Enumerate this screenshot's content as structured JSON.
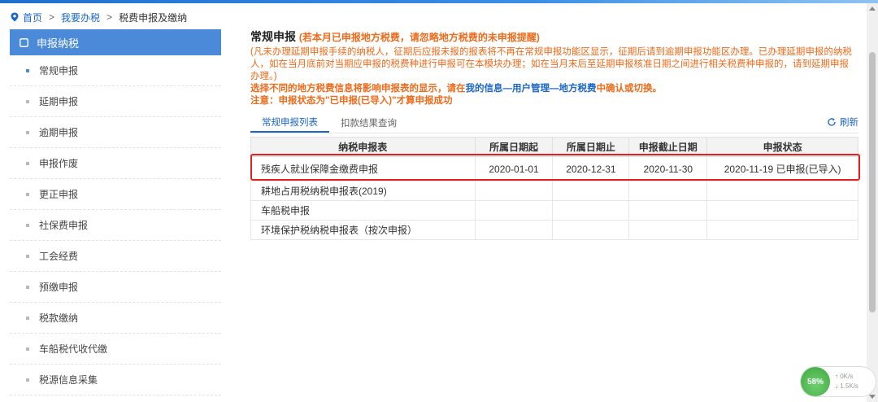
{
  "breadcrumb": {
    "home": "首页",
    "sep": ">",
    "level2": "我要办税",
    "current": "税费申报及缴纳"
  },
  "sidebar": {
    "header": "申报纳税",
    "items": [
      {
        "label": "常规申报",
        "active": true
      },
      {
        "label": "延期申报"
      },
      {
        "label": "逾期申报"
      },
      {
        "label": "申报作废"
      },
      {
        "label": "更正申报"
      },
      {
        "label": "社保费申报"
      },
      {
        "label": "工会经费"
      },
      {
        "label": "预缴申报"
      },
      {
        "label": "税款缴纳"
      },
      {
        "label": "车船税代收代缴"
      },
      {
        "label": "税源信息采集"
      }
    ]
  },
  "main": {
    "title": "常规申报",
    "title_hint": "(若本月已申报地方税费，请忽略地方税费的未申报提醒)",
    "notice": "(凡未办理延期申报手续的纳税人，征期后应报未报的报表将不再在常规申报功能区显示，征期后请到逾期申报功能区办理。已办理延期申报的纳税人，如在当月底前对当期应申报的税费种进行申报可在本模块办理；如在当月末后至延期申报核准日期之间进行相关税费种申报的，请到延期申报办理。)",
    "warn1_a": "选择不同的地方税费信息将影响申报表的显示，请在",
    "warn1_link": "我的信息—用户管理—地方税费",
    "warn1_b": "中确认或切换。",
    "warn2": "注意：申报状态为\"已申报(已导入)\"才算申报成功",
    "tabs": [
      "常规申报列表",
      "扣款结果查询"
    ],
    "refresh": "刷新",
    "table": {
      "headers": [
        "纳税申报表",
        "所属日期起",
        "所属日期止",
        "申报截止日期",
        "申报状态"
      ],
      "rows": [
        [
          "残疾人就业保障金缴费申报",
          "2020-01-01",
          "2020-12-31",
          "2020-11-30",
          "2020-11-19 已申报(已导入)"
        ],
        [
          "耕地占用税纳税申报表(2019)",
          "",
          "",
          "",
          ""
        ],
        [
          "车船税申报",
          "",
          "",
          "",
          ""
        ],
        [
          "环境保护税纳税申报表（按次申报）",
          "",
          "",
          "",
          ""
        ]
      ]
    }
  },
  "net_widget": {
    "percent": "58%",
    "up": "0K/s",
    "down": "1.5K/s"
  },
  "colors": {
    "accent": "#4a8ad8",
    "link": "#1a66c9",
    "warning": "#f06a1a",
    "highlight": "#e32020"
  }
}
